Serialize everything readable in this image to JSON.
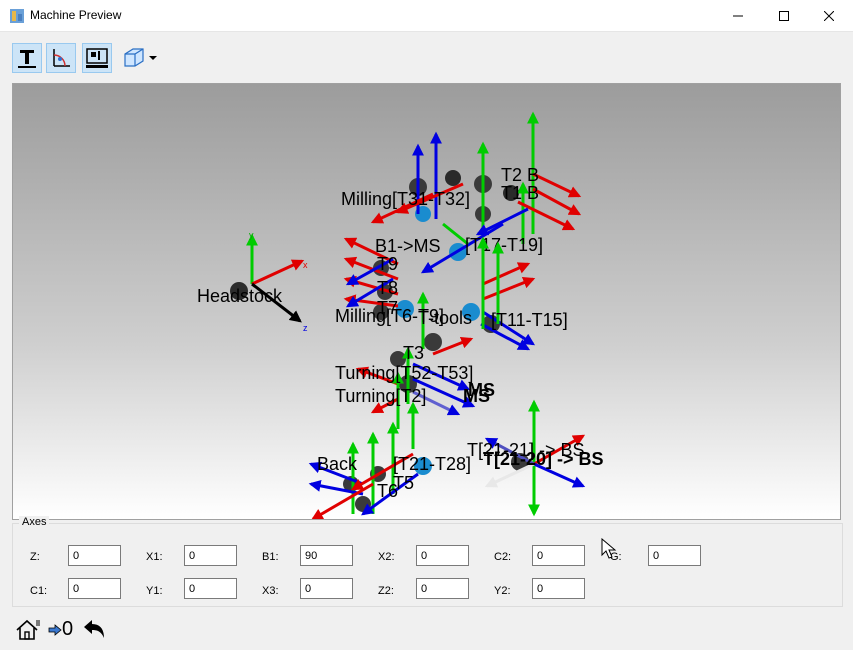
{
  "window": {
    "title": "Machine Preview"
  },
  "toolbar": {
    "buttons": [
      {
        "name": "toggle-labels-button",
        "icon": "text-T-icon",
        "active": true
      },
      {
        "name": "toggle-origin-button",
        "icon": "coordinate-origin-icon",
        "active": true
      },
      {
        "name": "toggle-tools-button",
        "icon": "tool-holder-icon",
        "active": true
      },
      {
        "name": "view-cube-button",
        "icon": "cube-icon",
        "active": false
      }
    ]
  },
  "scene": {
    "labels": {
      "headstock": "Headstock",
      "milling_top": "Milling[T31-T32]",
      "t2_b": "T2 B",
      "t1_b": "T1 B",
      "b1ms": "B1->MS",
      "ms17": "[T17-T19]",
      "milling_mid": "Milling[T6-T9]",
      "tools": "T-tools",
      "t11_15": "[T11-T15]",
      "turning1": "Turning[T52-T53]",
      "turning2": "Turning[T2]",
      "ms": "MS",
      "bs": "BS",
      "back": "Back",
      "t21_28": "[T21-T28]",
      "t21_bs": "T[21-21] -> BS",
      "t21_bs2": "T[21-20] -> BS",
      "t9": "T9",
      "t8": "T8",
      "t7": "T7",
      "t6": "T6",
      "t3": "T3",
      "t5": "T5",
      "x": "x",
      "y": "y",
      "z": "z"
    }
  },
  "axes": {
    "legend": "Axes",
    "row1": [
      {
        "label": "Z:",
        "value": "0"
      },
      {
        "label": "X1:",
        "value": "0"
      },
      {
        "label": "B1:",
        "value": "90"
      },
      {
        "label": "X2:",
        "value": "0"
      },
      {
        "label": "C2:",
        "value": "0"
      },
      {
        "label": "G:",
        "value": "0"
      }
    ],
    "row2": [
      {
        "label": "C1:",
        "value": "0"
      },
      {
        "label": "Y1:",
        "value": "0"
      },
      {
        "label": "X3:",
        "value": "0"
      },
      {
        "label": "Z2:",
        "value": "0"
      },
      {
        "label": "Y2:",
        "value": "0"
      }
    ]
  },
  "status": {
    "home_icon": "home-icon",
    "step_value": "0",
    "undo_icon": "undo-arrow-icon"
  },
  "colors": {
    "x_axis": "#e00000",
    "y_axis": "#00cc00",
    "z_axis": "#0000e0",
    "active_button": "#cce4f7"
  }
}
